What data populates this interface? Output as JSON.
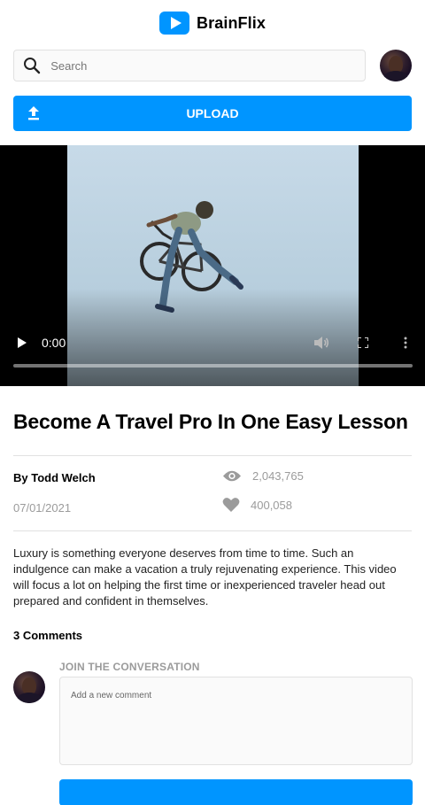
{
  "app": {
    "name": "BrainFlix",
    "brand_color": "#0095ff"
  },
  "search": {
    "placeholder": "Search",
    "icon": "search-icon"
  },
  "upload": {
    "label": "UPLOAD",
    "icon": "upload-icon"
  },
  "player": {
    "current_time": "0:00",
    "progress": 0,
    "icons": [
      "play-icon",
      "volume-icon",
      "fullscreen-icon",
      "more-icon"
    ]
  },
  "video": {
    "title": "Become A Travel Pro In One Easy Lesson",
    "author": "By Todd Welch",
    "date": "07/01/2021",
    "views": "2,043,765",
    "likes": "400,058",
    "description": "Luxury is something everyone deserves from time to time. Such an indulgence can make a vacation a truly rejuvenating experience. This video will focus a lot on helping the first time or inexperienced traveler head out prepared and confident in themselves."
  },
  "comments": {
    "count_label": "3 Comments",
    "join_label": "JOIN THE CONVERSATION",
    "placeholder": "Add a new comment"
  }
}
